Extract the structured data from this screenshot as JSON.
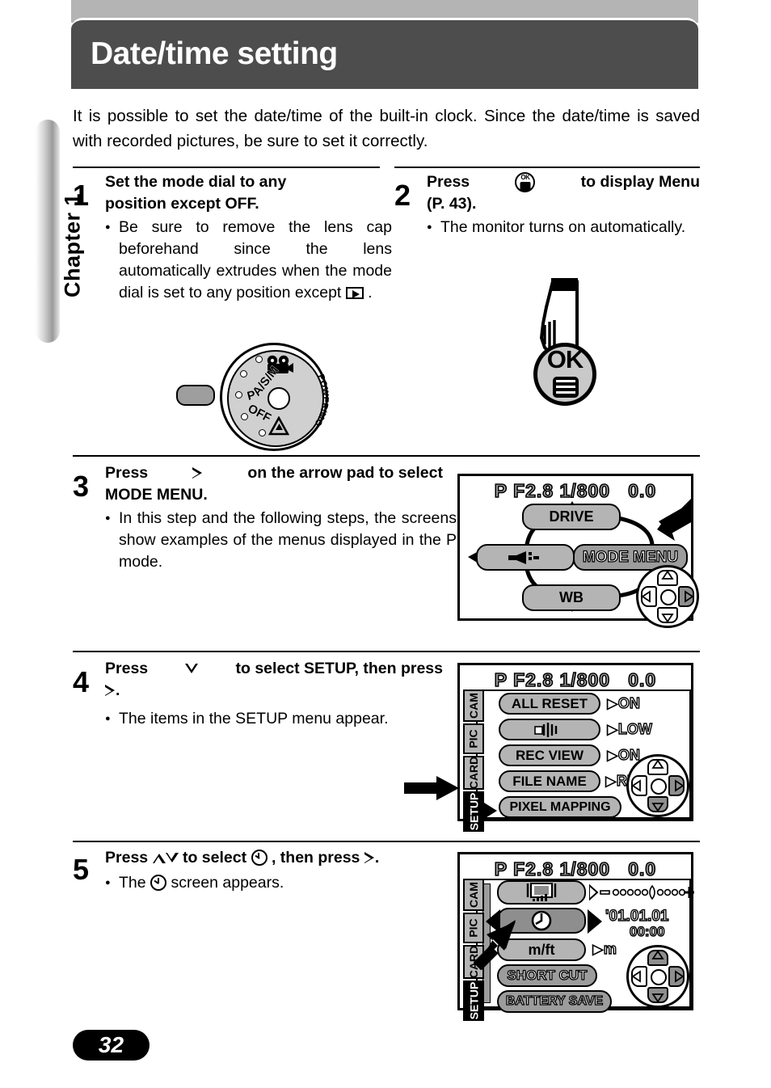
{
  "page": {
    "chapter_label": "Chapter 1",
    "title": "Date/time setting",
    "page_number": "32",
    "intro": "It is possible to set the date/time of the built-in clock. Since the date/time is saved with recorded pictures, be sure to set it correctly.",
    "colors": {
      "header_bg": "#4d4d4d",
      "topbar_bg": "#b4b4b4",
      "lcd_pill": "#b4b4b4",
      "lcd_text": "#ffffff"
    }
  },
  "steps": [
    {
      "number": "1",
      "title_a": "Set the mode dial to any",
      "title_b": "position except OFF.",
      "bullet_a": "Be sure to remove the lens cap beforehand since the lens automatically extrudes when the mode dial is set to any position",
      "bullet_b": "except",
      "bullet_c": "."
    },
    {
      "number": "2",
      "title_a": "Press",
      "title_b": "to display Menu",
      "title_c": "(P. 43).",
      "bullet_a": "The monitor turns on automatically."
    },
    {
      "number": "3",
      "title_a": "Press",
      "title_b": "on the arrow pad to select",
      "title_c": "MODE MENU.",
      "bullet_a": "In this step and the following steps, the screens show examples of the menus displayed in the P mode."
    },
    {
      "number": "4",
      "title_a": "Press",
      "title_b": "to select SETUP, then press",
      "title_c": ".",
      "bullet_a": "The items in the SETUP menu appear."
    },
    {
      "number": "5",
      "title_a": "Press",
      "title_b": "to select",
      "title_c": ", then press",
      "title_d": ".",
      "bullet_a": "The",
      "bullet_b": "screen appears."
    }
  ],
  "mode_dial": {
    "caption": "POWER/MODE DIAL",
    "positions": [
      "A/S/M",
      "P",
      "OFF"
    ],
    "movie_icon": "movie-camera-icon",
    "playback_icon": "playback-icon"
  },
  "ok_button": {
    "label": "OK",
    "menu_icon": "menu-list-icon"
  },
  "lcd_status": {
    "mode": "P",
    "aperture": "F2.8",
    "shutter": "1/800",
    "exposure": "0.0"
  },
  "screen3": {
    "top": "DRIVE",
    "left": "flash-icon",
    "right": "MODE MENU",
    "bottom": "WB",
    "pad_highlight": "right"
  },
  "screen4": {
    "tabs": [
      "CAM",
      "PIC",
      "CARD",
      "SETUP"
    ],
    "selected_tab": "SETUP",
    "items": [
      {
        "label": "ALL RESET",
        "value": "ON"
      },
      {
        "label": "beep-speaker-icon",
        "value": "LOW",
        "is_icon": true
      },
      {
        "label": "REC VIEW",
        "value": "ON"
      },
      {
        "label": "FILE NAME",
        "value": "RESET"
      },
      {
        "label": "PIXEL MAPPING",
        "value": ""
      }
    ],
    "pad_highlight": "right-and-down"
  },
  "screen5": {
    "tabs": [
      "CAM",
      "PIC",
      "CARD",
      "SETUP"
    ],
    "selected_tab": "SETUP",
    "items": [
      {
        "label": "monitor-brightness-icon",
        "value": "brightness-slider",
        "is_icon": true
      },
      {
        "label": "clock-icon",
        "value_date": "'01.01.01",
        "value_time": "00:00",
        "is_icon": true,
        "selected": true
      },
      {
        "label": "m/ft",
        "value": "m"
      },
      {
        "label": "SHORT CUT",
        "value": ""
      },
      {
        "label": "BATTERY SAVE",
        "value": ""
      }
    ],
    "pad_highlight": "all"
  }
}
